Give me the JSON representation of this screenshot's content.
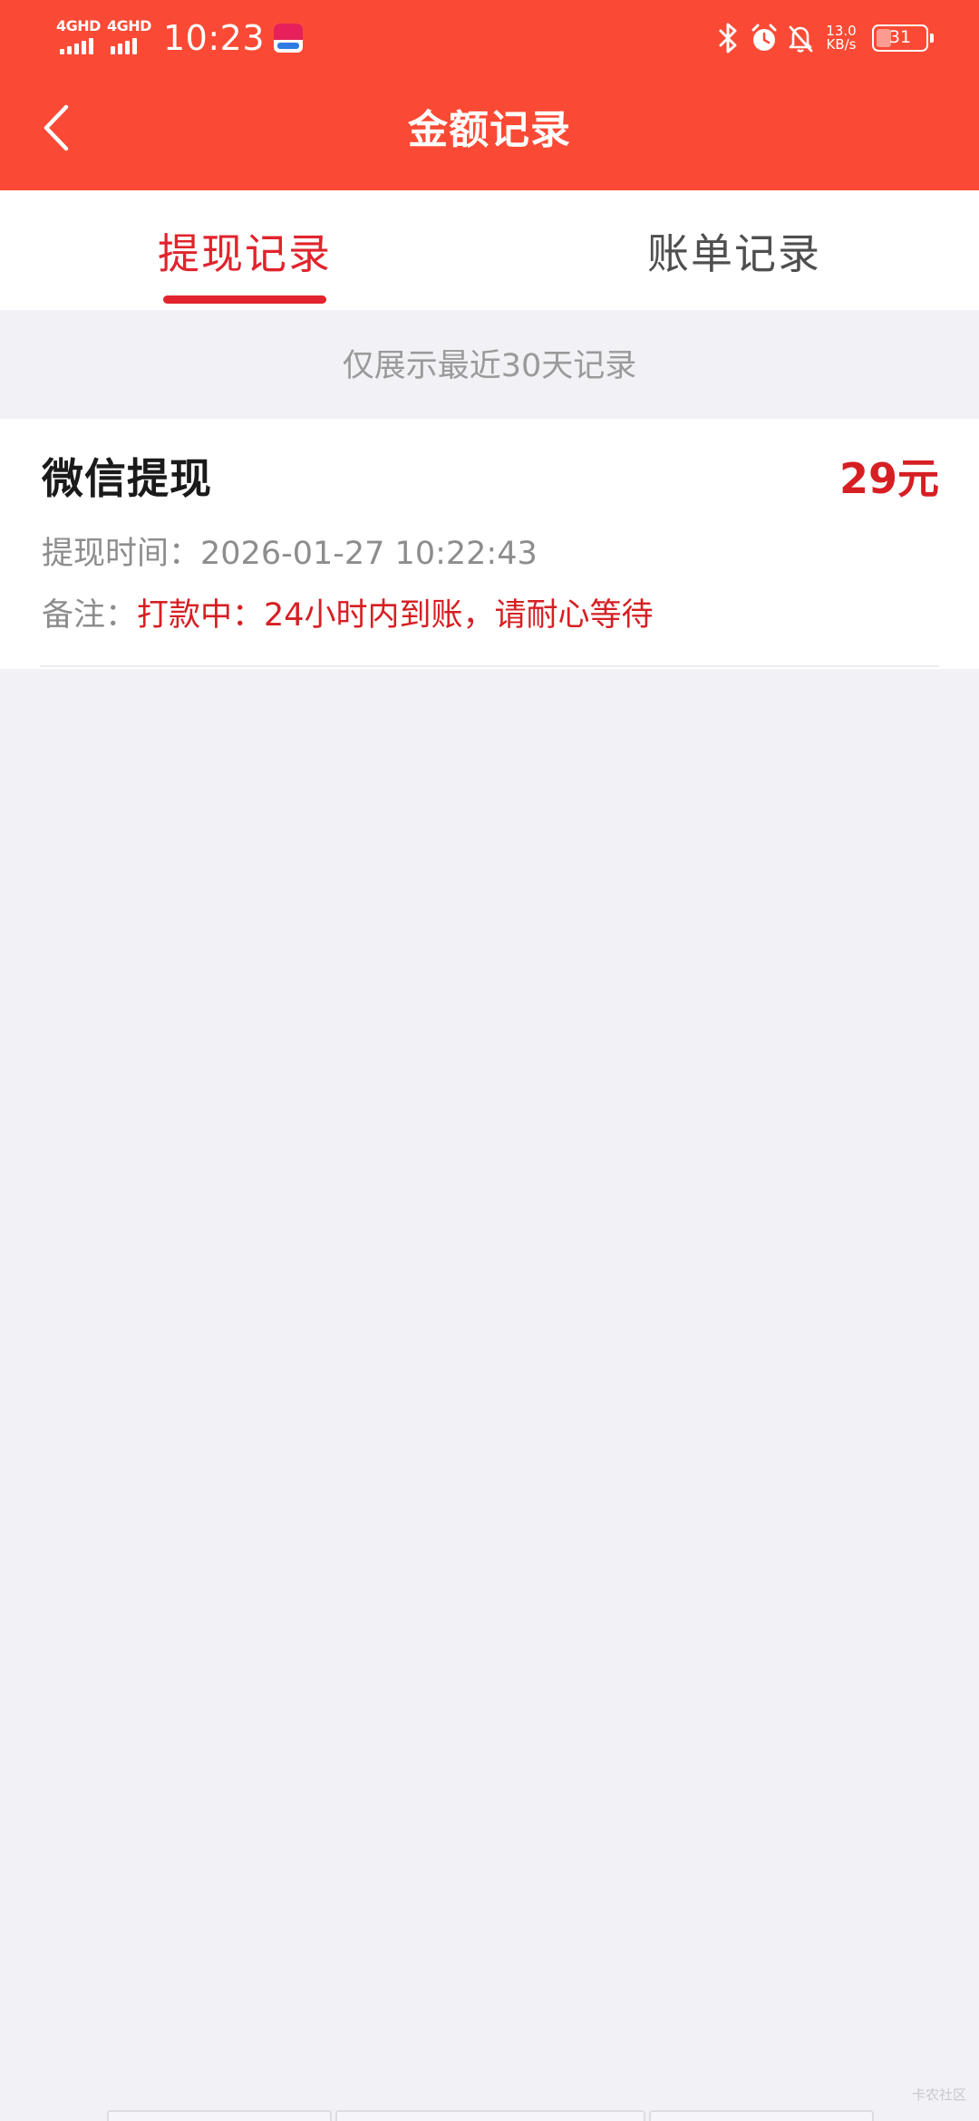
{
  "status_bar": {
    "network_1": "4GHD",
    "network_2": "4GHD",
    "time": "10:23",
    "app_icon_label": "赏帮",
    "net_speed_value": "13.0",
    "net_speed_unit": "KB/s",
    "battery_level": 31,
    "battery_text": "31",
    "icons": [
      "bluetooth-icon",
      "alarm-icon",
      "notifications-muted-icon"
    ]
  },
  "header": {
    "title": "金额记录",
    "background_color": "#fa4a35"
  },
  "tabs": [
    {
      "label": "提现记录",
      "active": true
    },
    {
      "label": "账单记录",
      "active": false
    }
  ],
  "notice": "仅展示最近30天记录",
  "records": [
    {
      "title": "微信提现",
      "amount": "29元",
      "time_label": "提现时间：",
      "time_value": "2026-01-27 10:22:43",
      "note_label": "备注：",
      "note_value": "打款中：24小时内到账，请耐心等待"
    }
  ],
  "watermark": "卡农社区",
  "colors": {
    "accent_red": "#e1242d",
    "amount_red": "#d61f23",
    "page_background": "#f1f1f6"
  }
}
